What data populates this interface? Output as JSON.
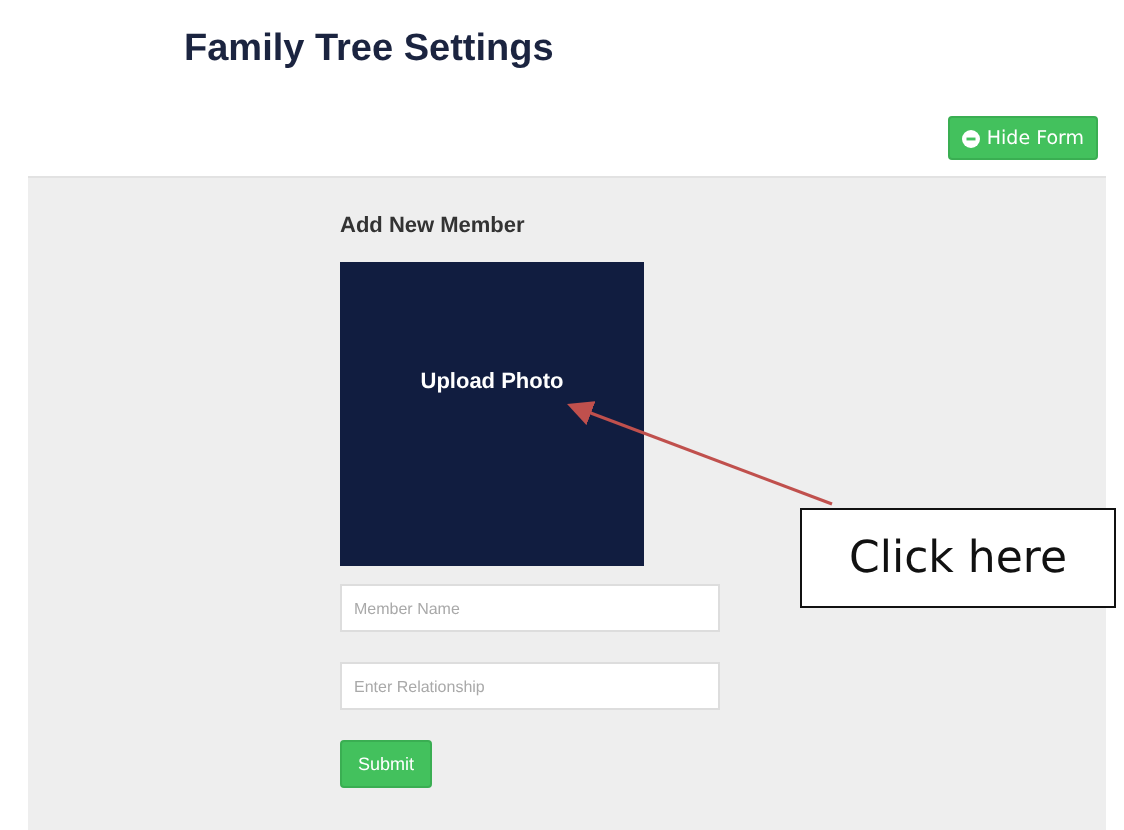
{
  "page_title": "Family Tree Settings",
  "hide_form_button": {
    "label": "Hide Form"
  },
  "form": {
    "heading": "Add New Member",
    "photo_upload": {
      "label": "Upload Photo"
    },
    "fields": [
      {
        "placeholder": "Member Name"
      },
      {
        "placeholder": "Enter Relationship"
      }
    ],
    "submit_button": {
      "label": "Submit"
    }
  },
  "annotation": {
    "callout": "Click here"
  }
}
